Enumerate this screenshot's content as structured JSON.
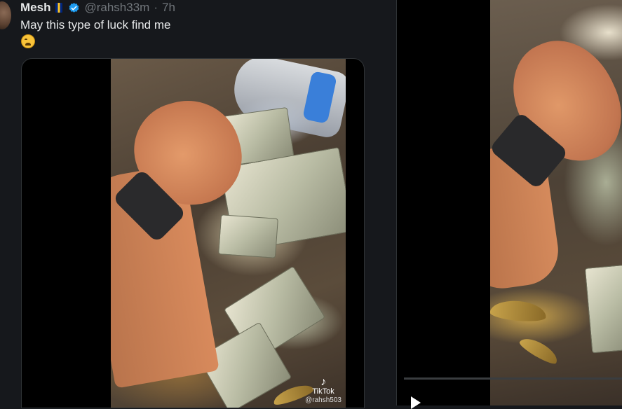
{
  "post": {
    "display_name": "Mesh",
    "handle": "@rahsh33m",
    "separator": "·",
    "time": "7h",
    "text": "May this type of luck find me",
    "emoji": "weary-face-emoji",
    "flag": "barbados-flag-icon",
    "verified": "verified-badge-icon"
  },
  "media": {
    "watermark_brand": "TikTok",
    "watermark_handle": "@rahsh503"
  },
  "colors": {
    "background": "#16181c",
    "text": "#e7e9ea",
    "muted": "#71767b",
    "verified": "#1d9bf0"
  }
}
